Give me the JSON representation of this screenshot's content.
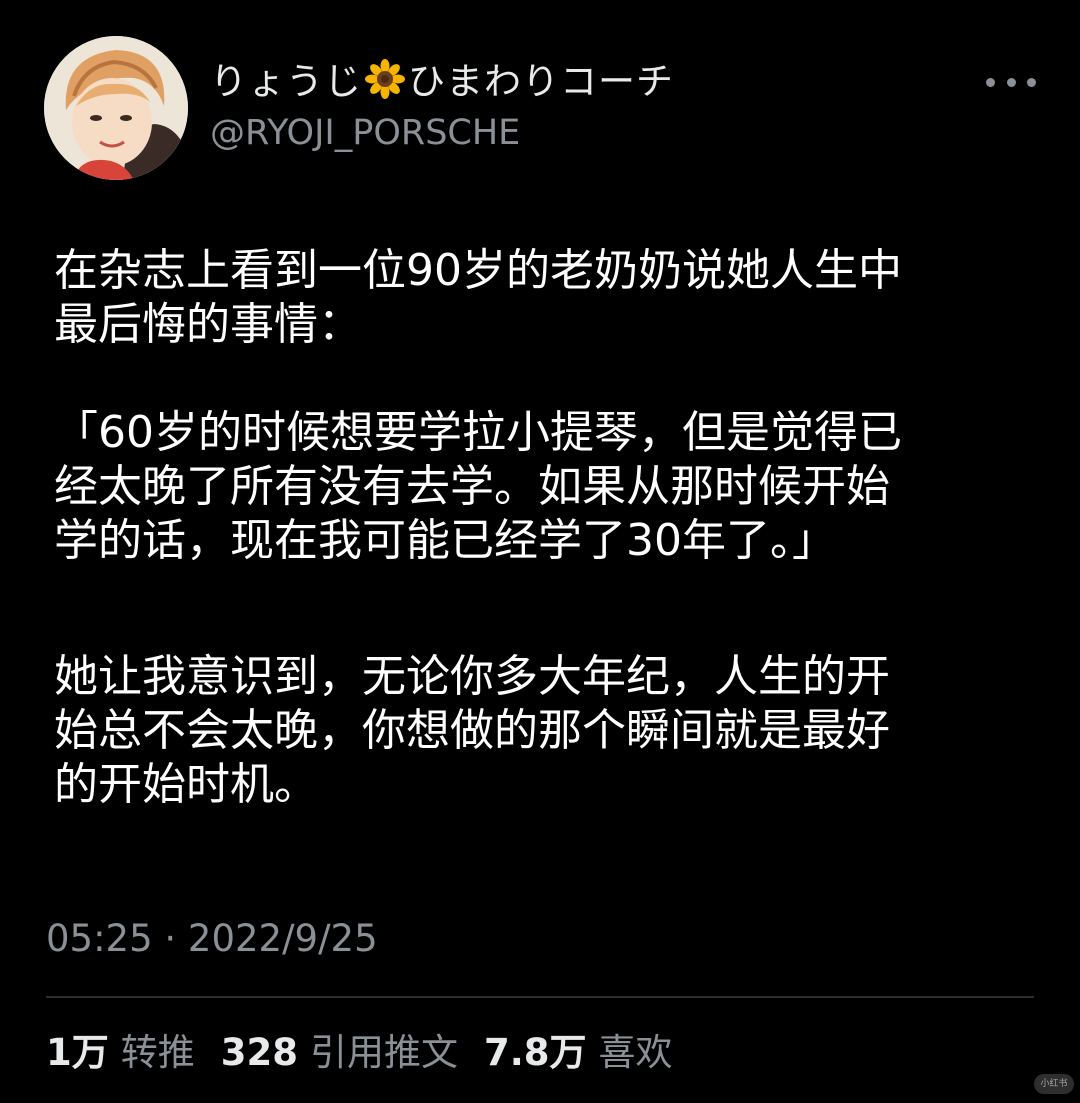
{
  "author": {
    "name_part1": "りょうじ",
    "name_part2": "ひまわりコーチ",
    "emoji_icon": "sunflower-emoji",
    "handle": "@RYOJI_PORSCHE"
  },
  "menu": {
    "icon": "more-horizontal-icon"
  },
  "tweet": {
    "paragraph1": [
      "在杂志上看到一位90岁的老奶奶说她人生中",
      "最后悔的事情："
    ],
    "paragraph2": [
      "「60岁的时候想要学拉小提琴，但是觉得已",
      "经太晚了所有没有去学。如果从那时候开始",
      "学的话，现在我可能已经学了30年了。」"
    ],
    "paragraph3": [
      "她让我意识到，无论你多大年纪，人生的开",
      "始总不会太晚，你想做的那个瞬间就是最好",
      "的开始时机。"
    ],
    "timestamp": "05:25 · 2022/9/25"
  },
  "stats": {
    "retweets_count": "1万",
    "retweets_label": "转推",
    "quotes_count": "328",
    "quotes_label": "引用推文",
    "likes_count": "7.8万",
    "likes_label": "喜欢"
  },
  "watermark": {
    "text": "小红书"
  },
  "colors": {
    "background": "#000000",
    "primary_text": "#ffffff",
    "secondary_text": "#8b9096",
    "divider": "#2b2e32"
  }
}
